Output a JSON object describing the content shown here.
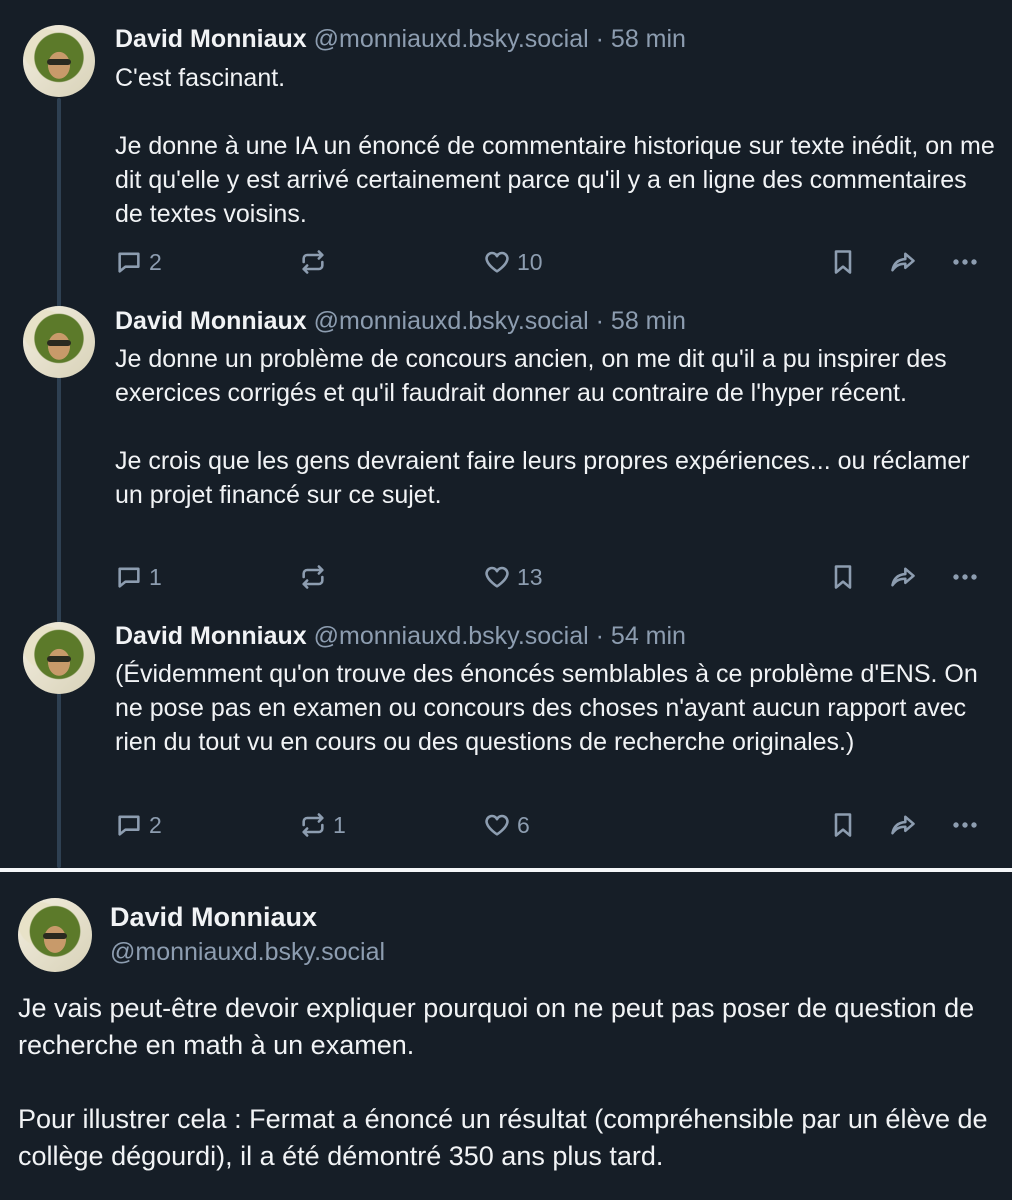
{
  "posts": [
    {
      "author": "David Monniaux",
      "handle": "@monniauxd.bsky.social",
      "separator": "·",
      "time": "58 min",
      "text": "C'est fascinant.\n\nJe donne à une IA un énoncé de commentaire historique sur texte inédit, on me dit qu'elle y est arrivé certainement parce qu'il y a en ligne des commentaires de textes voisins.",
      "replies": "2",
      "reposts": "",
      "likes": "10"
    },
    {
      "author": "David Monniaux",
      "handle": "@monniauxd.bsky.social",
      "separator": "·",
      "time": "58 min",
      "text": "Je donne un problème de concours ancien, on me dit qu'il a pu inspirer des exercices corrigés et qu'il faudrait donner au contraire de l'hyper récent.\n\nJe crois que les gens devraient faire leurs propres expériences... ou réclamer un projet financé sur ce sujet.",
      "replies": "1",
      "reposts": "",
      "likes": "13"
    },
    {
      "author": "David Monniaux",
      "handle": "@monniauxd.bsky.social",
      "separator": "·",
      "time": "54 min",
      "text": "(Évidemment qu'on trouve des énoncés semblables à ce problème d'ENS. On ne pose pas en examen ou concours des choses n'ayant aucun rapport avec rien du tout vu en cours ou des questions de recherche originales.)",
      "replies": "2",
      "reposts": "1",
      "likes": "6"
    }
  ],
  "main_post": {
    "author": "David Monniaux",
    "handle": "@monniauxd.bsky.social",
    "text": "Je vais peut-être devoir expliquer pourquoi on ne peut pas poser de question de recherche en math à un examen.\n\nPour illustrer cela : Fermat a énoncé un résultat (compréhensible par un élève de collège dégourdi), il a été démontré 350 ans plus tard."
  },
  "colors": {
    "background": "#161e27",
    "text": "#f1f3f5",
    "muted": "#8d9db0",
    "thread_line": "#2e4052"
  }
}
